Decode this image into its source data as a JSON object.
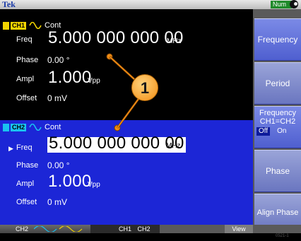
{
  "topbar": {
    "brand": "Tek",
    "mode_badge": "Num",
    "lock_icon": "lock-icon"
  },
  "ch1": {
    "tag": "CH1",
    "mode": "Cont",
    "color": "#f2d400",
    "freq_label": "Freq",
    "freq_value": "5.000 000 000 00",
    "freq_unit": "MHz",
    "phase_label": "Phase",
    "phase_value": "0.00 °",
    "ampl_label": "Ampl",
    "ampl_value": "1.000",
    "ampl_unit": "Vpp",
    "offset_label": "Offset",
    "offset_value": "0 mV"
  },
  "ch2": {
    "tag": "CH2",
    "mode": "Cont",
    "color": "#19c2f0",
    "freq_label": "Freq",
    "freq_value": "5.000 000 000 00",
    "freq_unit": "MHz",
    "phase_label": "Phase",
    "phase_value": "0.00 °",
    "ampl_label": "Ampl",
    "ampl_value": "1.000",
    "ampl_unit": "Vpp",
    "offset_label": "Offset",
    "offset_value": "0 mV",
    "selected_indicator": "▶"
  },
  "side_buttons": {
    "frequency": "Frequency",
    "period": "Period",
    "freq_link_line1": "Frequency",
    "freq_link_line2": "CH1=CH2",
    "toggle_off": "Off",
    "toggle_on": "On",
    "phase": "Phase",
    "align_phase": "Align Phase"
  },
  "bottom": {
    "ch2_label": "CH2",
    "ch1_label": "CH1",
    "ch2b_label": "CH2",
    "view": "View"
  },
  "callout": {
    "number": "1"
  },
  "figure_code": "0521-1"
}
